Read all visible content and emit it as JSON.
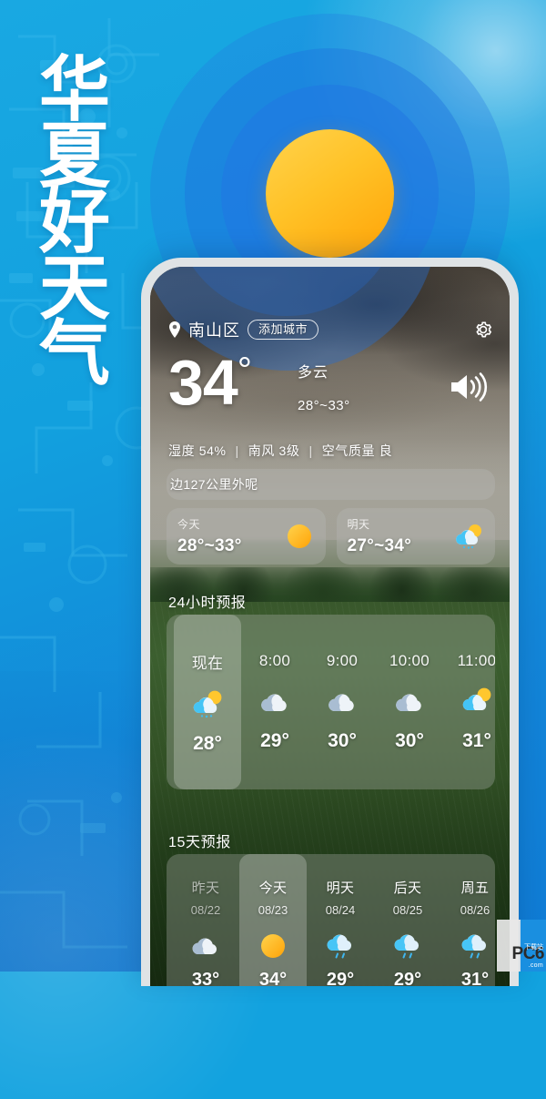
{
  "promo": {
    "headline_chars": [
      "华",
      "夏",
      "好",
      "天",
      "气"
    ],
    "bg_color": "#12a2df",
    "sun_color_light": "#ffd34d",
    "sun_color_dark": "#ffa307",
    "ring_color": "#2678e1"
  },
  "app": {
    "location": {
      "pin_icon": "location-pin-icon",
      "city": "南山区",
      "add_city_label": "添加城市",
      "settings_icon": "gear-icon"
    },
    "current": {
      "temperature": "34",
      "degree": "°",
      "condition": "多云",
      "range": "28°~33°",
      "speaker_icon": "speaker-volume-icon"
    },
    "stats": {
      "humidity": "湿度 54%",
      "wind": "南风 3级",
      "air_quality": "空气质量 良",
      "separator": "|"
    },
    "banner": {
      "text": "边127公里外呢"
    },
    "duo": [
      {
        "label": "今天",
        "range": "28°~33°",
        "icon": "sun-icon"
      },
      {
        "label": "明天",
        "range": "27°~34°",
        "icon": "partly-cloudy-icon"
      }
    ],
    "hourly": {
      "title": "24小时预报",
      "items": [
        {
          "time": "现在",
          "icon": "partly-cloudy-icon",
          "temp": "28°",
          "active": true
        },
        {
          "time": "8:00",
          "icon": "cloudy-icon",
          "temp": "29°",
          "active": false
        },
        {
          "time": "9:00",
          "icon": "cloudy-icon",
          "temp": "30°",
          "active": false
        },
        {
          "time": "10:00",
          "icon": "cloudy-icon",
          "temp": "30°",
          "active": false
        },
        {
          "time": "11:00",
          "icon": "partly-cloudy-icon",
          "temp": "31°",
          "active": false
        }
      ]
    },
    "daily": {
      "title": "15天预报",
      "items": [
        {
          "label": "昨天",
          "date": "08/22",
          "icon": "cloudy-icon",
          "temp": "33°",
          "active": false,
          "past": true
        },
        {
          "label": "今天",
          "date": "08/23",
          "icon": "sun-icon",
          "temp": "34°",
          "active": true,
          "past": false
        },
        {
          "label": "明天",
          "date": "08/24",
          "icon": "rain-icon",
          "temp": "29°",
          "active": false,
          "past": false
        },
        {
          "label": "后天",
          "date": "08/25",
          "icon": "rain-icon",
          "temp": "29°",
          "active": false,
          "past": false
        },
        {
          "label": "周五",
          "date": "08/26",
          "icon": "rain-icon",
          "temp": "31°",
          "active": false,
          "past": false
        }
      ]
    }
  },
  "watermark": {
    "brand": "PC6",
    "domain": ".com",
    "subtitle": "下载站"
  }
}
